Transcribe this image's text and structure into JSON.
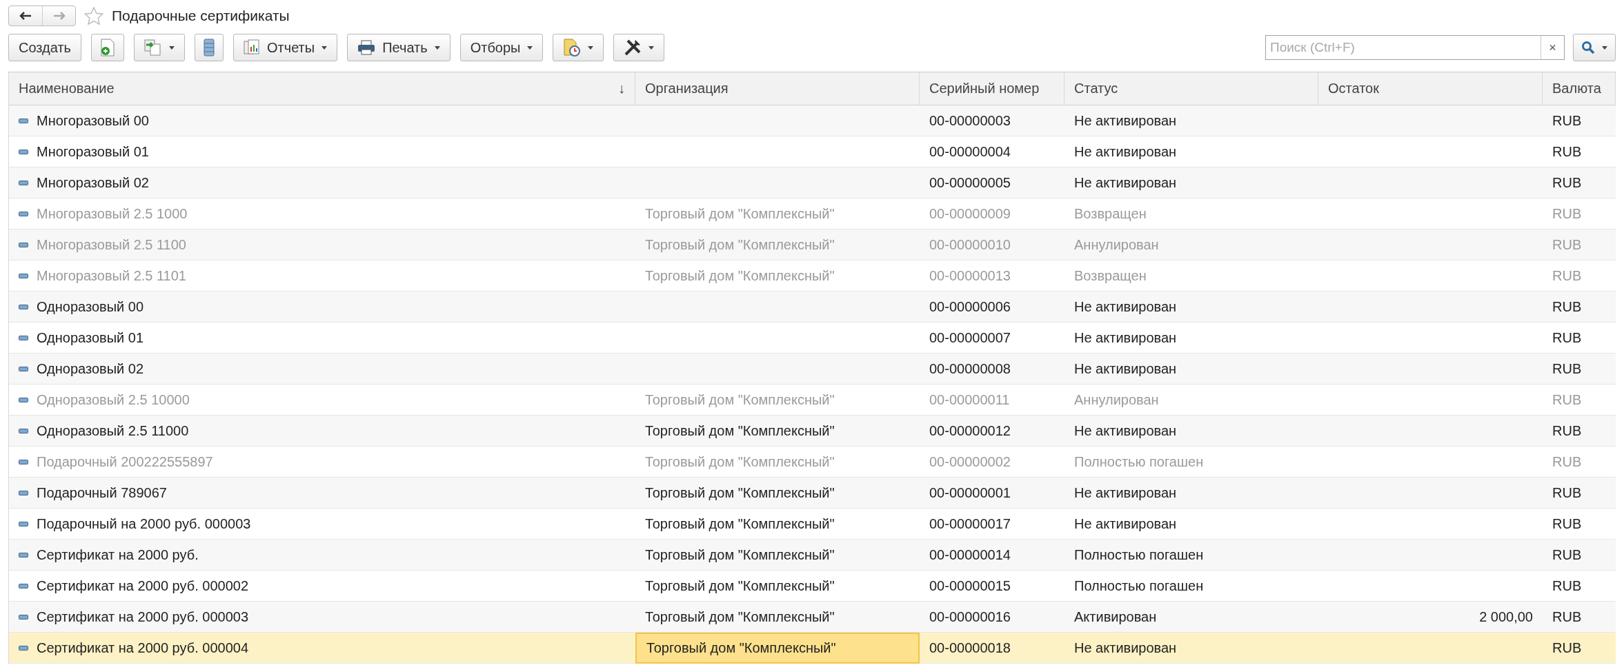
{
  "window": {
    "title": "Подарочные сертификаты"
  },
  "toolbar": [
    {
      "kind": "text",
      "label": "Создать",
      "dropdown": false
    },
    {
      "kind": "icon",
      "dropdown": false
    },
    {
      "kind": "icon",
      "dropdown": true
    },
    {
      "kind": "icon",
      "dropdown": false
    },
    {
      "kind": "text",
      "label": "Отчеты",
      "dropdown": true
    },
    {
      "kind": "text",
      "label": "Печать",
      "dropdown": true
    },
    {
      "kind": "text",
      "label": "Отборы",
      "dropdown": true
    },
    {
      "kind": "icon",
      "dropdown": true
    },
    {
      "kind": "icon",
      "dropdown": true
    }
  ],
  "search": {
    "placeholder": "Поиск (Ctrl+F)",
    "clear": "×"
  },
  "table": {
    "columns": [
      {
        "label": "Наименование",
        "sort_mark": "↓"
      },
      {
        "label": "Организация"
      },
      {
        "label": "Серийный номер"
      },
      {
        "label": "Статус"
      },
      {
        "label": "Остаток"
      },
      {
        "label": "Валюта"
      }
    ],
    "rows": [
      {
        "name": "Многоразовый 00",
        "org": "",
        "serial": "00-00000003",
        "status": "Не активирован",
        "balance": "",
        "currency": "RUB",
        "dimmed": false,
        "selected": false
      },
      {
        "name": "Многоразовый 01",
        "org": "",
        "serial": "00-00000004",
        "status": "Не активирован",
        "balance": "",
        "currency": "RUB",
        "dimmed": false,
        "selected": false
      },
      {
        "name": "Многоразовый 02",
        "org": "",
        "serial": "00-00000005",
        "status": "Не активирован",
        "balance": "",
        "currency": "RUB",
        "dimmed": false,
        "selected": false
      },
      {
        "name": "Многоразовый 2.5 1000",
        "org": "Торговый дом \"Комплексный\"",
        "serial": "00-00000009",
        "status": "Возвращен",
        "balance": "",
        "currency": "RUB",
        "dimmed": true,
        "selected": false
      },
      {
        "name": "Многоразовый 2.5 1100",
        "org": "Торговый дом \"Комплексный\"",
        "serial": "00-00000010",
        "status": "Аннулирован",
        "balance": "",
        "currency": "RUB",
        "dimmed": true,
        "selected": false
      },
      {
        "name": "Многоразовый 2.5 1101",
        "org": "Торговый дом \"Комплексный\"",
        "serial": "00-00000013",
        "status": "Возвращен",
        "balance": "",
        "currency": "RUB",
        "dimmed": true,
        "selected": false
      },
      {
        "name": "Одноразовый 00",
        "org": "",
        "serial": "00-00000006",
        "status": "Не активирован",
        "balance": "",
        "currency": "RUB",
        "dimmed": false,
        "selected": false
      },
      {
        "name": "Одноразовый 01",
        "org": "",
        "serial": "00-00000007",
        "status": "Не активирован",
        "balance": "",
        "currency": "RUB",
        "dimmed": false,
        "selected": false
      },
      {
        "name": "Одноразовый 02",
        "org": "",
        "serial": "00-00000008",
        "status": "Не активирован",
        "balance": "",
        "currency": "RUB",
        "dimmed": false,
        "selected": false
      },
      {
        "name": "Одноразовый 2.5 10000",
        "org": "Торговый дом \"Комплексный\"",
        "serial": "00-00000011",
        "status": "Аннулирован",
        "balance": "",
        "currency": "RUB",
        "dimmed": true,
        "selected": false
      },
      {
        "name": "Одноразовый 2.5 11000",
        "org": "Торговый дом \"Комплексный\"",
        "serial": "00-00000012",
        "status": "Не активирован",
        "balance": "",
        "currency": "RUB",
        "dimmed": false,
        "selected": false
      },
      {
        "name": "Подарочный 200222555897",
        "org": "Торговый дом \"Комплексный\"",
        "serial": "00-00000002",
        "status": "Полностью погашен",
        "balance": "",
        "currency": "RUB",
        "dimmed": true,
        "selected": false
      },
      {
        "name": "Подарочный 789067",
        "org": "Торговый дом \"Комплексный\"",
        "serial": "00-00000001",
        "status": "Не активирован",
        "balance": "",
        "currency": "RUB",
        "dimmed": false,
        "selected": false
      },
      {
        "name": "Подарочный на 2000 руб. 000003",
        "org": "Торговый дом \"Комплексный\"",
        "serial": "00-00000017",
        "status": "Не активирован",
        "balance": "",
        "currency": "RUB",
        "dimmed": false,
        "selected": false
      },
      {
        "name": "Сертификат на 2000 руб.",
        "org": "Торговый дом \"Комплексный\"",
        "serial": "00-00000014",
        "status": "Полностью погашен",
        "balance": "",
        "currency": "RUB",
        "dimmed": false,
        "selected": false
      },
      {
        "name": "Сертификат на 2000 руб. 000002",
        "org": "Торговый дом \"Комплексный\"",
        "serial": "00-00000015",
        "status": "Полностью погашен",
        "balance": "",
        "currency": "RUB",
        "dimmed": false,
        "selected": false
      },
      {
        "name": "Сертификат на 2000 руб. 000003",
        "org": "Торговый дом \"Комплексный\"",
        "serial": "00-00000016",
        "status": "Активирован",
        "balance": "2 000,00",
        "currency": "RUB",
        "dimmed": false,
        "selected": false
      },
      {
        "name": "Сертификат на 2000 руб. 000004",
        "org": "Торговый дом \"Комплексный\"",
        "serial": "00-00000018",
        "status": "Не активирован",
        "balance": "",
        "currency": "RUB",
        "dimmed": false,
        "selected": true
      }
    ]
  }
}
